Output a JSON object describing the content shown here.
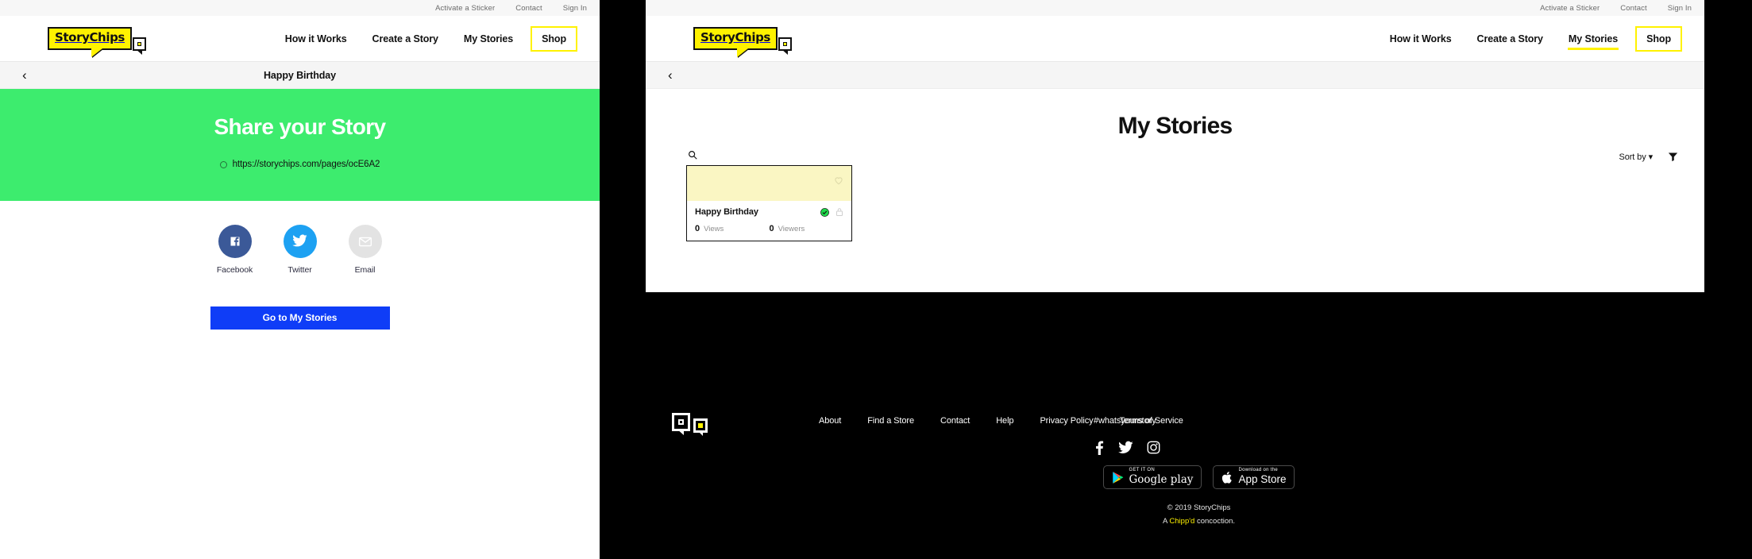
{
  "brand": {
    "name": "StoryChips",
    "yellow": "#fff200",
    "green": "#3dec6e",
    "blue": "#0f3df7"
  },
  "utility_nav": [
    {
      "label": "Activate a Sticker"
    },
    {
      "label": "Contact"
    },
    {
      "label": "Sign In"
    }
  ],
  "main_nav": [
    {
      "label": "How it Works"
    },
    {
      "label": "Create a Story"
    },
    {
      "label": "My Stories"
    },
    {
      "label": "Shop"
    }
  ],
  "left_panel": {
    "subheader": {
      "title": "Happy Birthday",
      "back_icon": "chevron-left-icon"
    },
    "hero": {
      "heading": "Share your Story",
      "url": "https://storychips.com/pages/ocE6A2"
    },
    "share": [
      {
        "label": "Facebook",
        "icon": "facebook-icon",
        "color": "#3b5998"
      },
      {
        "label": "Twitter",
        "icon": "twitter-icon",
        "color": "#1da1f2"
      },
      {
        "label": "Email",
        "icon": "email-icon",
        "color": "#e3e3e3"
      }
    ],
    "cta": {
      "label": "Go to My Stories"
    }
  },
  "right_panel": {
    "subheader": {
      "back_icon": "chevron-left-icon"
    },
    "page_title": "My Stories",
    "search": {
      "icon": "search-icon",
      "value": "",
      "placeholder": ""
    },
    "sort": {
      "label": "Sort by",
      "caret": "▾"
    },
    "filter": {
      "icon": "filter-funnel-icon"
    },
    "cards": [
      {
        "title": "Happy Birthday",
        "heart_icon": "heart-outline-icon",
        "verified_icon": "check-circle-icon",
        "lock_icon": "lock-icon",
        "stats": [
          {
            "value": "0",
            "label": "Views"
          },
          {
            "value": "0",
            "label": "Viewers"
          }
        ]
      }
    ]
  },
  "footer": {
    "links": [
      {
        "label": "About"
      },
      {
        "label": "Find a Store"
      },
      {
        "label": "Contact"
      },
      {
        "label": "Help"
      },
      {
        "label": "Privacy Policy"
      },
      {
        "label": "Terms of Service"
      }
    ],
    "hashtag": "#whatsyourstory",
    "social": [
      {
        "icon": "facebook-icon"
      },
      {
        "icon": "twitter-icon"
      },
      {
        "icon": "instagram-icon"
      }
    ],
    "store_badges": [
      {
        "sub": "GET IT ON",
        "main": "Google play",
        "icon": "google-play-icon"
      },
      {
        "sub": "Download on the",
        "main": "App Store",
        "icon": "apple-icon"
      }
    ],
    "copyright": "© 2019 StoryChips",
    "tagline_prefix": "A ",
    "tagline_brand": "Chipp'd",
    "tagline_suffix": " concoction."
  }
}
